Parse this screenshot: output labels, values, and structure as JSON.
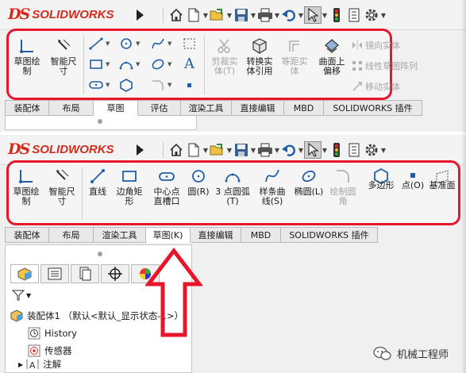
{
  "brand": {
    "logo_glyph": "DS",
    "logo_text": "SOLIDWORKS",
    "color": "#d52b1e"
  },
  "highlight_color": "#e8162a",
  "top_window": {
    "ribbon": {
      "sketch": "草图绘\n制",
      "smart_dim": "智能尺\n寸",
      "trim": "剪裁实\n体(T)",
      "convert": "转换实\n体引用",
      "offset": "等距实\n体",
      "surface_offset": "曲面上\n偏移",
      "mirror": "镜向实体",
      "linear_pattern": "线性草图阵列",
      "move": "移动实体"
    },
    "tabs": [
      "装配体",
      "布局",
      "草图",
      "评估",
      "渲染工具",
      "直接编辑",
      "MBD",
      "SOLIDWORKS 插件"
    ],
    "active_tab": 2
  },
  "bottom_window": {
    "ribbon": {
      "sketch": "草图绘\n制",
      "smart_dim": "智能尺\n寸",
      "line": "直线",
      "corner_rect": "边角矩\n形",
      "slot": "中心点\n直槽口",
      "circle": "圆(R)",
      "arc": "3 点圆弧\n(T)",
      "spline": "样条曲\n线(S)",
      "ellipse": "椭圆(L)",
      "fillet": "绘制圆\n角",
      "polygon": "多边形",
      "point": "点(O)",
      "ref_plane": "基准面"
    },
    "tabs": [
      "装配体",
      "布局",
      "渲染工具",
      "草图(K)",
      "直接编辑",
      "MBD",
      "SOLIDWORKS 插件"
    ],
    "active_tab": 3,
    "tree": {
      "root": "装配体1 （默认<默认_显示状态-1>）",
      "items": [
        "History",
        "传感器",
        "注解"
      ]
    }
  },
  "watermark": "机械工程师"
}
